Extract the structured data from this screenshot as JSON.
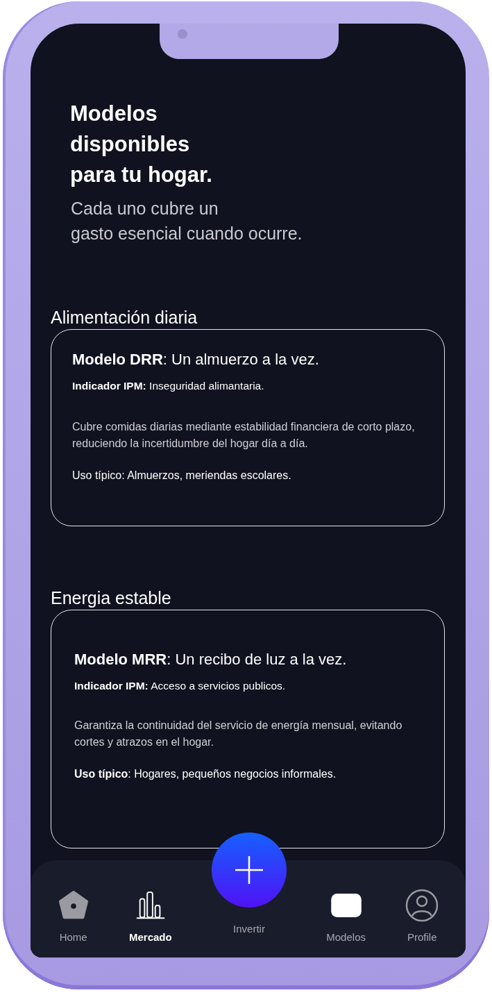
{
  "header": {
    "title": "Modelos\ndisponibles\npara tu hogar.",
    "subtitle": "Cada uno cubre un\ngasto esencial cuando ocurre."
  },
  "sections": [
    {
      "heading": "Alimentación diaria",
      "card": {
        "title": "**Modelo DRR**: Un almuerzo a la vez.",
        "indicator": "**Indicador IPM:** Inseguridad alimantaria.",
        "description": "Cubre comidas diarias mediante estabilidad financiera de corto plazo, reduciendo la incertidumbre del hogar día a día.",
        "usage": "Uso típico: Almuerzos, meriendas escolares."
      }
    },
    {
      "heading": "Energia estable",
      "card": {
        "title": "**Modelo MRR**: Un recibo de luz a la vez.",
        "indicator": "**Indicador IPM:** Acceso a servicios publicos.",
        "description": "Garantiza la continuidad del servicio de energía mensual, evitando cortes y atrazos en el hogar.",
        "usage": "**Uso típico**: Hogares, pequeños negocios informales."
      }
    }
  ],
  "bottom_nav": [
    {
      "label": "Home",
      "kind": "home",
      "selected": false
    },
    {
      "label": "Mercado",
      "kind": "chart",
      "selected": true
    },
    {
      "label": "Invertir",
      "kind": "fab",
      "selected": false
    },
    {
      "label": "Modelos",
      "kind": "tile",
      "selected": false
    },
    {
      "label": "Profile",
      "kind": "profile",
      "selected": false
    }
  ]
}
